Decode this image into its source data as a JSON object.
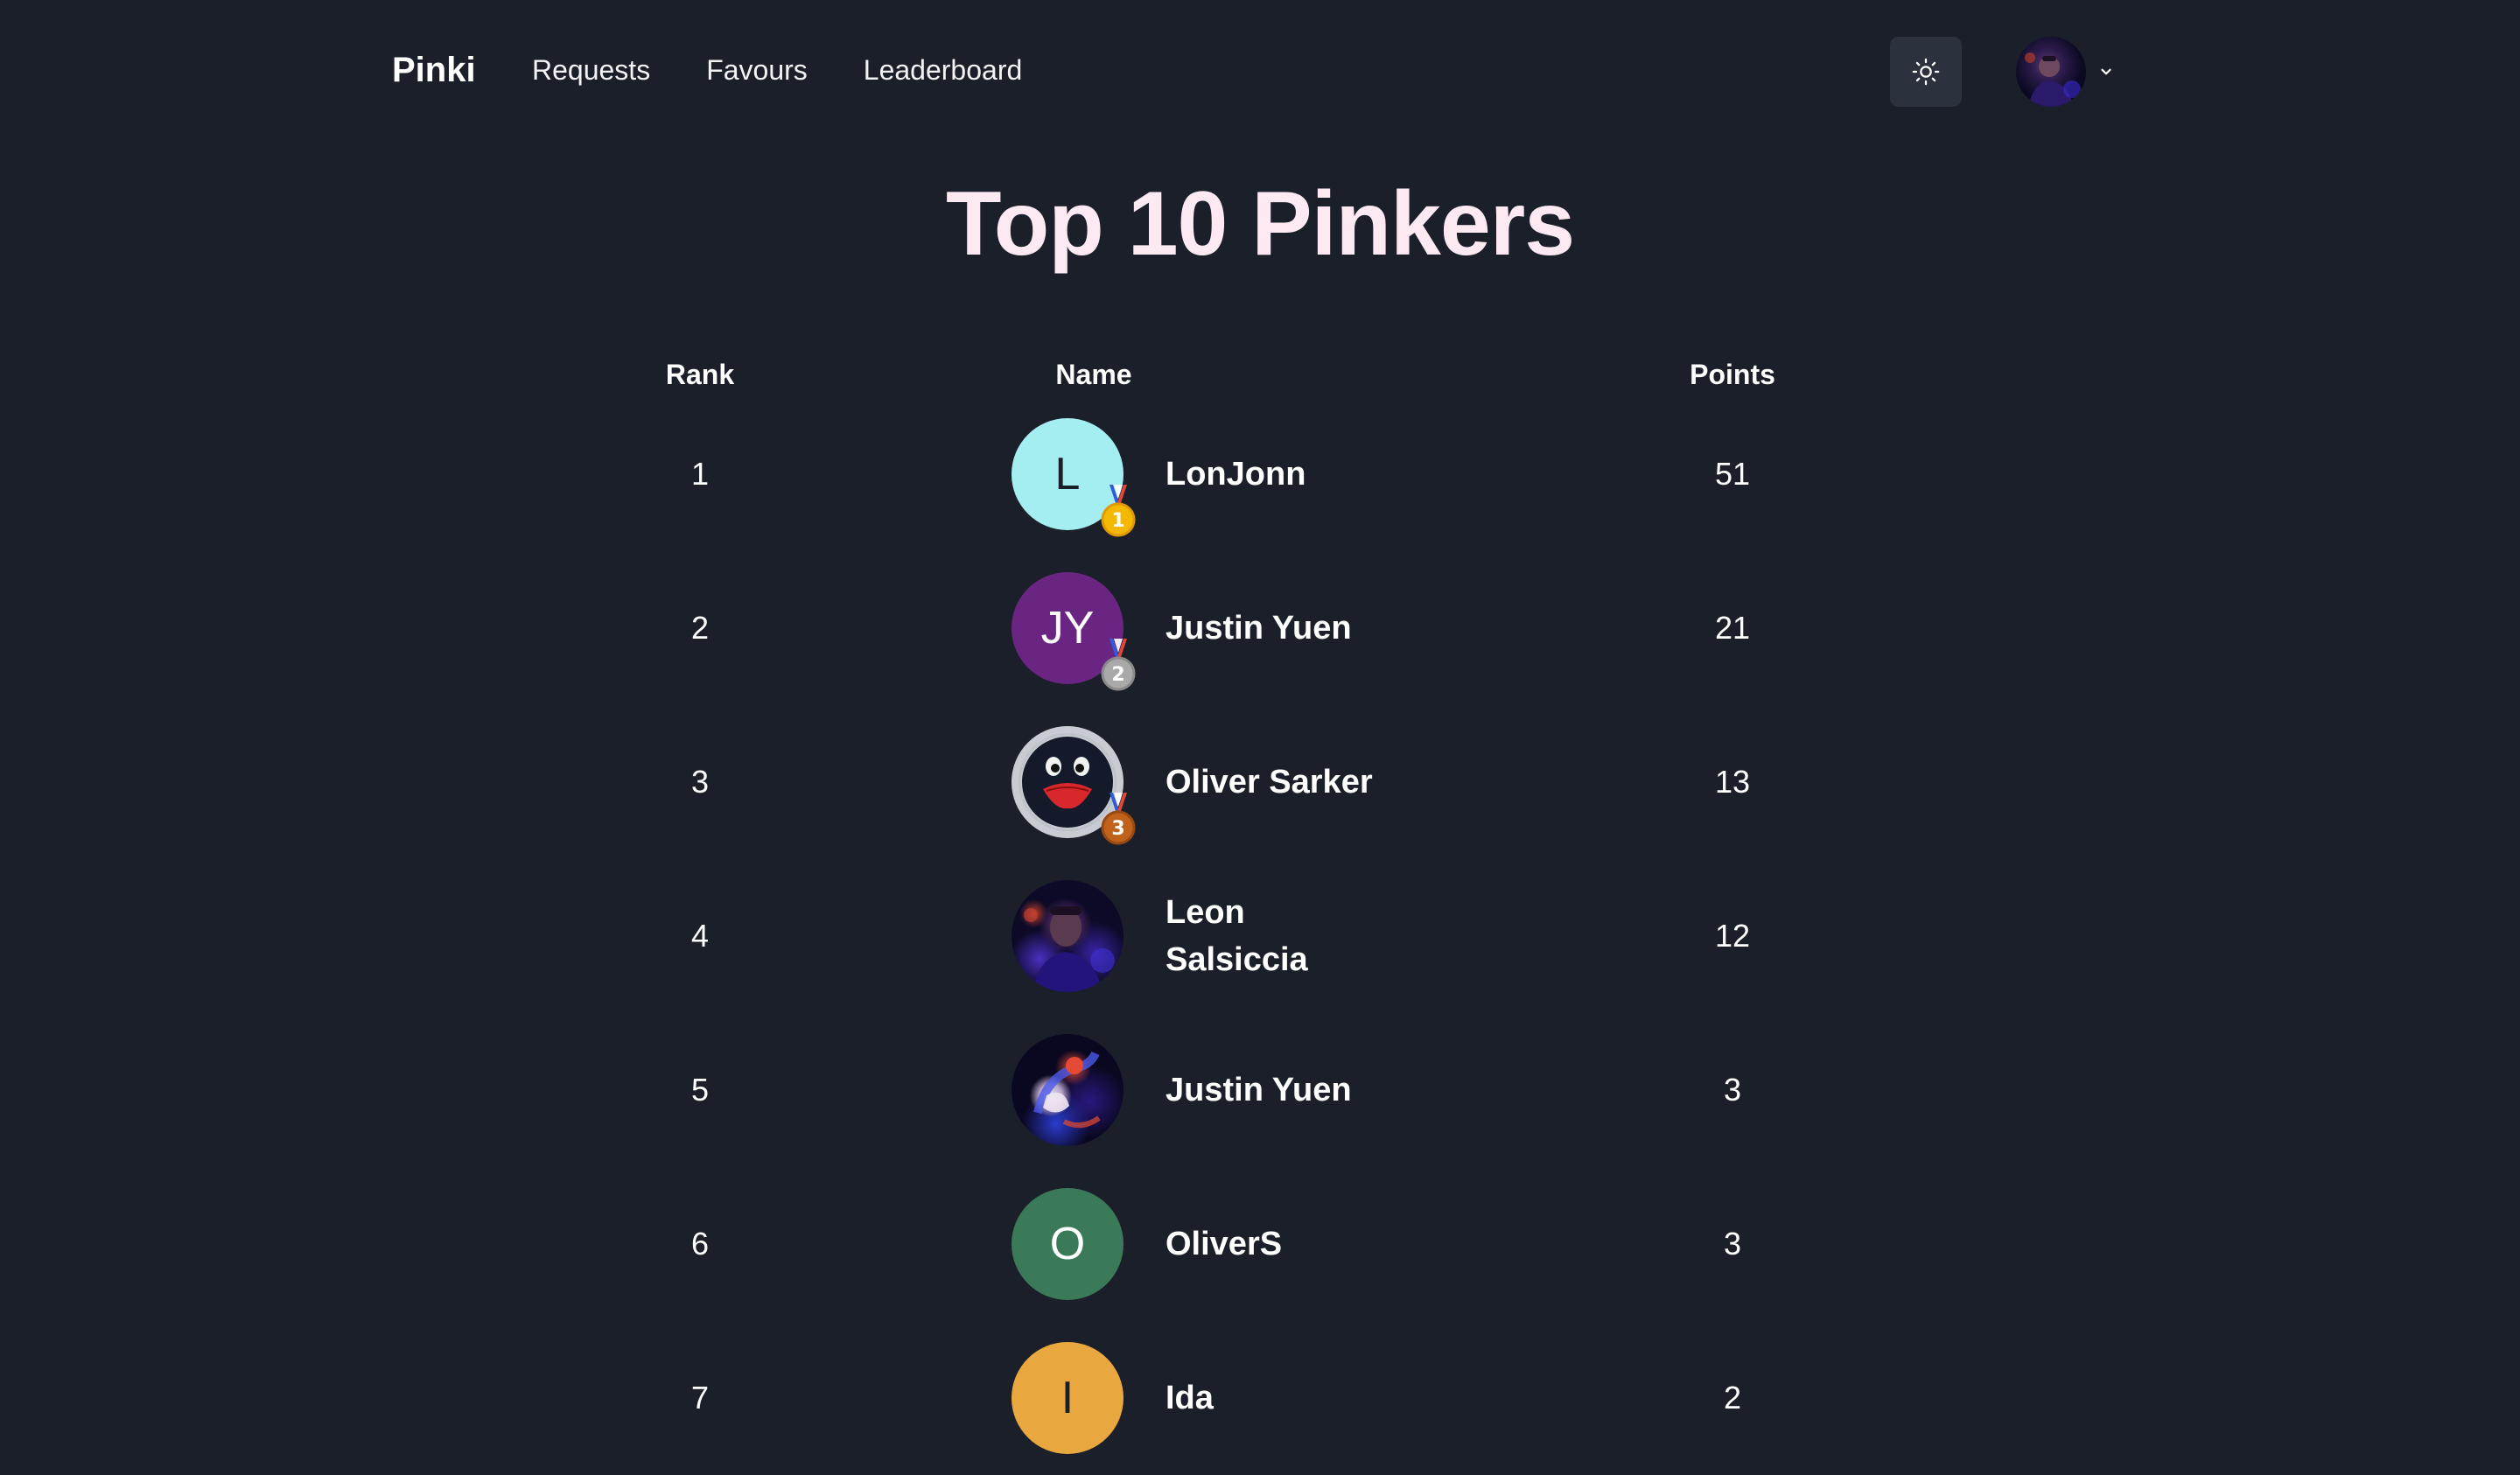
{
  "nav": {
    "brand": "Pinki",
    "links": [
      "Requests",
      "Favours",
      "Leaderboard"
    ],
    "theme_toggle_icon": "sun-icon",
    "user_menu_icon": "chevron-down-icon"
  },
  "page": {
    "title": "Top 10 Pinkers"
  },
  "table": {
    "headers": {
      "rank": "Rank",
      "name": "Name",
      "points": "Points"
    },
    "rows": [
      {
        "rank": "1",
        "initials": "L",
        "name": "LonJonn",
        "points": "51",
        "medal": "1",
        "avatar_color": "#a4eef2"
      },
      {
        "rank": "2",
        "initials": "JY",
        "name": "Justin Yuen",
        "points": "21",
        "medal": "2",
        "avatar_color": "#6a2582"
      },
      {
        "rank": "3",
        "initials": "",
        "name": "Oliver Sarker",
        "points": "13",
        "medal": "3",
        "avatar_color": ""
      },
      {
        "rank": "4",
        "initials": "",
        "name": "Leon Salsiccia",
        "points": "12",
        "medal": "",
        "avatar_color": ""
      },
      {
        "rank": "5",
        "initials": "",
        "name": "Justin Yuen",
        "points": "3",
        "medal": "",
        "avatar_color": ""
      },
      {
        "rank": "6",
        "initials": "O",
        "name": "OliverS",
        "points": "3",
        "medal": "",
        "avatar_color": "#3b7a58"
      },
      {
        "rank": "7",
        "initials": "I",
        "name": "Ida",
        "points": "2",
        "medal": "",
        "avatar_color": "#e9a83f"
      }
    ]
  },
  "colors": {
    "background": "#1b1f29",
    "title": "#fde9f1",
    "toggle_bg": "#2c323d",
    "gold": "#f5b800",
    "silver": "#a9a9a9",
    "bronze": "#c0611c"
  }
}
